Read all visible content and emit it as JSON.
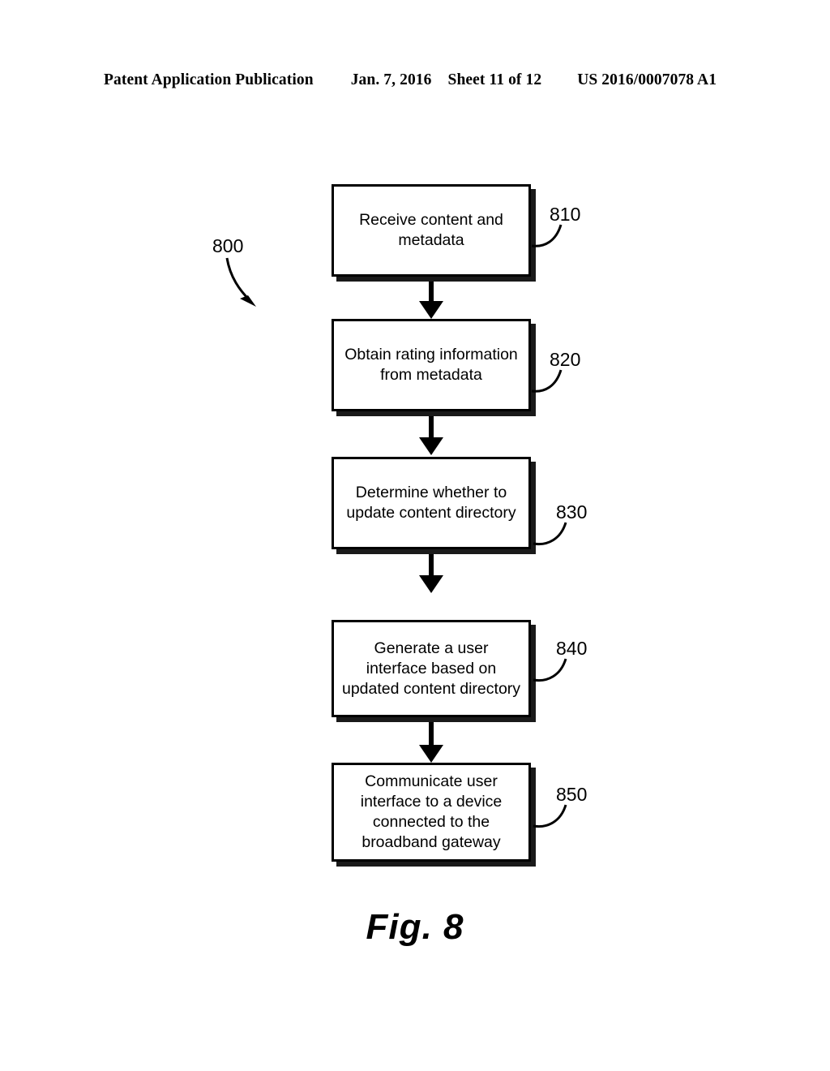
{
  "header": {
    "publication": "Patent Application Publication",
    "date": "Jan. 7, 2016",
    "sheet": "Sheet 11 of 12",
    "patent_number": "US 2016/0007078 A1"
  },
  "figure": {
    "caption": "Fig. 8",
    "diagram_ref": "800",
    "type": "flowchart",
    "steps": [
      {
        "ref": "810",
        "text": "Receive content and\nmetadata"
      },
      {
        "ref": "820",
        "text": "Obtain rating information\nfrom metadata"
      },
      {
        "ref": "830",
        "text": "Determine whether to\nupdate content directory"
      },
      {
        "ref": "840",
        "text": "Generate a user\ninterface based on\nupdated content directory"
      },
      {
        "ref": "850",
        "text": "Communicate user\ninterface to a device\nconnected to the\nbroadband gateway"
      }
    ]
  },
  "colors": {
    "ink": "#000000",
    "paper": "#ffffff",
    "shadow": "#1a1a1a"
  }
}
